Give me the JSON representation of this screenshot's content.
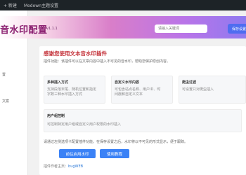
{
  "adminbar": {
    "items": [
      "+ 新建",
      "Modown主题设置"
    ]
  },
  "sidebar": {
    "items": [
      "置",
      "文案"
    ]
  },
  "header": {
    "title": "音水印配置",
    "version": "v1.1.1",
    "search_placeholder": "请输入关键词",
    "primary_button": "保存设置"
  },
  "main": {
    "title": "感谢您使用文本音水印插件",
    "description": "插件功能：该插件可以在文章内容中插入不可见的音水印，帮助您保护原创内容。",
    "cards": [
      {
        "title": "多种插入方式",
        "text": "支持段落末尾、随机位置和指定字数三种水印插入方式"
      },
      {
        "title": "自定义水印内容",
        "text": "可包含站点名称、用户ID、时间戳和自定义文本"
      },
      {
        "title": "爬虫过滤",
        "text": "可设置只对爬虫插入"
      }
    ],
    "wide_card": {
      "title": "用户组控制",
      "text": "可控制特定用户组或自定义用户权限的水印插入"
    },
    "note": "请通过左侧选项卡配置插件功能。在保存设置之后，水印将以不可见的形式显示，便于跟踪。",
    "buttons": {
      "start": "前往启用水印",
      "docs": "使用教程"
    },
    "author_label": "插件作者主页：",
    "author_link": "bugWEB"
  }
}
